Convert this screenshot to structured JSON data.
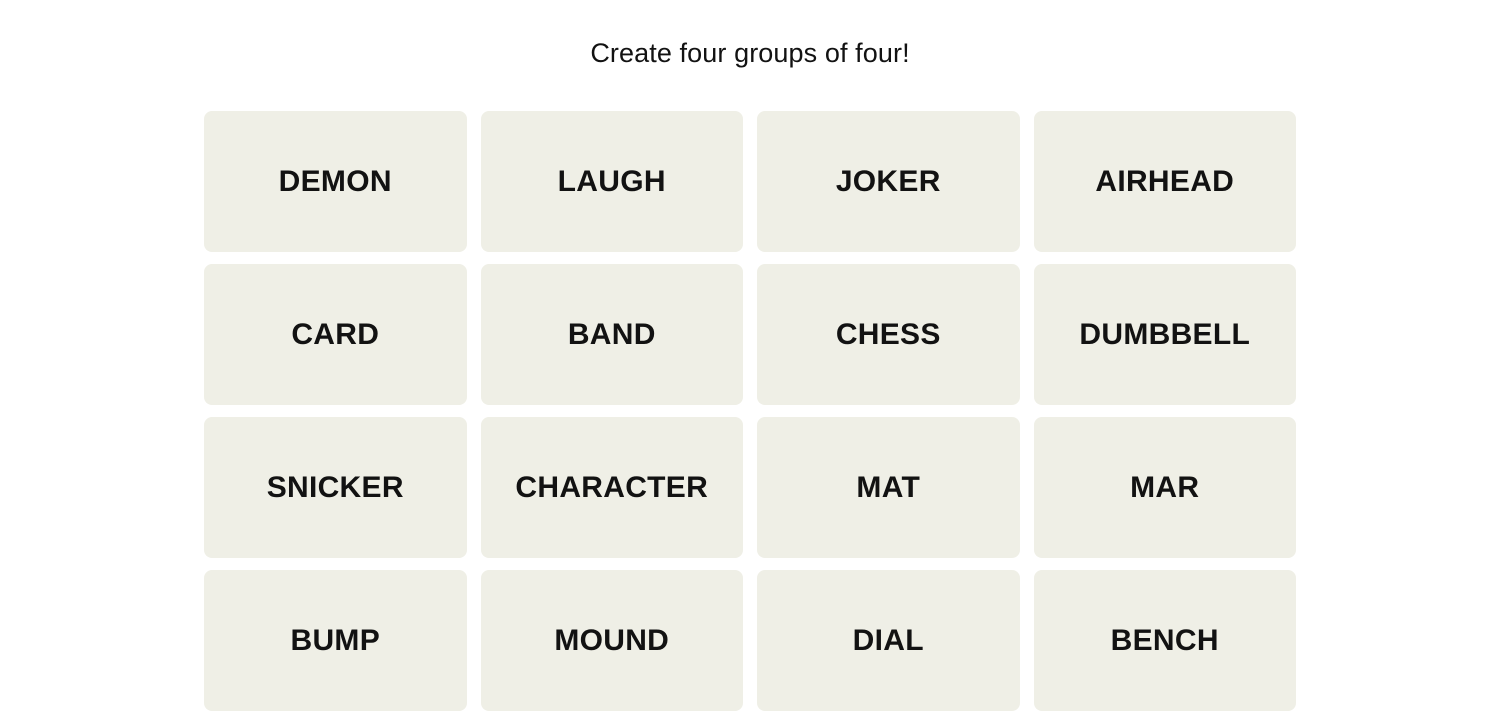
{
  "page": {
    "background_color": "#ffffff",
    "title": "Create four groups of four!"
  },
  "theme": {
    "tile_background": "#efefe6",
    "tile_text_color": "#121212",
    "title_color": "#121212"
  },
  "board": {
    "rows": 4,
    "columns": 4,
    "tiles": [
      {
        "label": "DEMON"
      },
      {
        "label": "LAUGH"
      },
      {
        "label": "JOKER"
      },
      {
        "label": "AIRHEAD"
      },
      {
        "label": "CARD"
      },
      {
        "label": "BAND"
      },
      {
        "label": "CHESS"
      },
      {
        "label": "DUMBBELL"
      },
      {
        "label": "SNICKER"
      },
      {
        "label": "CHARACTER"
      },
      {
        "label": "MAT"
      },
      {
        "label": "MAR"
      },
      {
        "label": "BUMP"
      },
      {
        "label": "MOUND"
      },
      {
        "label": "DIAL"
      },
      {
        "label": "BENCH"
      }
    ]
  }
}
